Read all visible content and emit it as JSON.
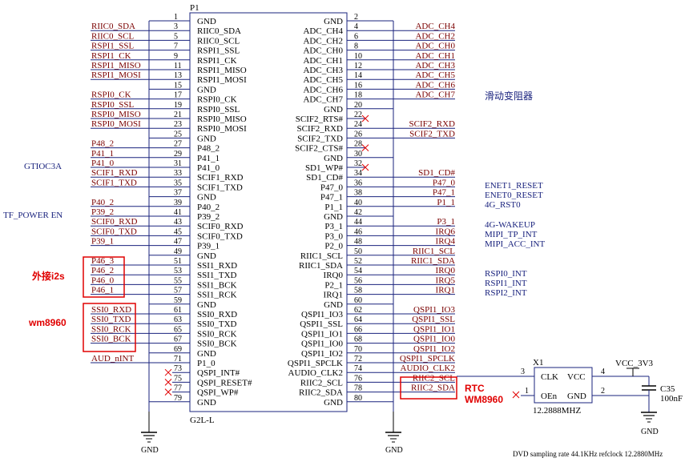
{
  "part": {
    "ref": "P1",
    "value": "G2L-L",
    "left_pins": [
      {
        "num": "1",
        "name": "GND",
        "net": ""
      },
      {
        "num": "3",
        "name": "RIIC0_SDA",
        "net": "RIIC0_SDA"
      },
      {
        "num": "5",
        "name": "RIIC0_SCL",
        "net": "RIIC0_SCL"
      },
      {
        "num": "7",
        "name": "RSPI1_SSL",
        "net": "RSPI1_SSL"
      },
      {
        "num": "9",
        "name": "RSPI1_CK",
        "net": "RSPI1_CK"
      },
      {
        "num": "11",
        "name": "RSPI1_MISO",
        "net": "RSPI1_MISO"
      },
      {
        "num": "13",
        "name": "RSPI1_MOSI",
        "net": "RSPI1_MOSI"
      },
      {
        "num": "15",
        "name": "GND",
        "net": ""
      },
      {
        "num": "17",
        "name": "RSPI0_CK",
        "net": "RSPI0_CK"
      },
      {
        "num": "19",
        "name": "RSPI0_SSL",
        "net": "RSPI0_SSL"
      },
      {
        "num": "21",
        "name": "RSPI0_MISO",
        "net": "RSPI0_MISO"
      },
      {
        "num": "23",
        "name": "RSPI0_MOSI",
        "net": "RSPI0_MOSI"
      },
      {
        "num": "25",
        "name": "GND",
        "net": ""
      },
      {
        "num": "27",
        "name": "P48_2",
        "net": "P48_2"
      },
      {
        "num": "29",
        "name": "P41_1",
        "net": "P41_1"
      },
      {
        "num": "31",
        "name": "P41_0",
        "net": "P41_0"
      },
      {
        "num": "33",
        "name": "SCIF1_RXD",
        "net": "SCIF1_RXD"
      },
      {
        "num": "35",
        "name": "SCIF1_TXD",
        "net": "SCIF1_TXD"
      },
      {
        "num": "37",
        "name": "GND",
        "net": ""
      },
      {
        "num": "39",
        "name": "P40_2",
        "net": "P40_2"
      },
      {
        "num": "41",
        "name": "P39_2",
        "net": "P39_2"
      },
      {
        "num": "43",
        "name": "SCIF0_RXD",
        "net": "SCIF0_RXD"
      },
      {
        "num": "45",
        "name": "SCIF0_TXD",
        "net": "SCIF0_TXD"
      },
      {
        "num": "47",
        "name": "P39_1",
        "net": "P39_1"
      },
      {
        "num": "49",
        "name": "GND",
        "net": ""
      },
      {
        "num": "51",
        "name": "SSI1_RXD",
        "net": "P46_3"
      },
      {
        "num": "53",
        "name": "SSI1_TXD",
        "net": "P46_2"
      },
      {
        "num": "55",
        "name": "SSI1_BCK",
        "net": "P46_0"
      },
      {
        "num": "57",
        "name": "SSI1_RCK",
        "net": "P46_1"
      },
      {
        "num": "59",
        "name": "GND",
        "net": ""
      },
      {
        "num": "61",
        "name": "SSI0_RXD",
        "net": "SSI0_RXD"
      },
      {
        "num": "63",
        "name": "SSI0_TXD",
        "net": "SSI0_TXD"
      },
      {
        "num": "65",
        "name": "SSI0_RCK",
        "net": "SSI0_RCK"
      },
      {
        "num": "67",
        "name": "SSI0_BCK",
        "net": "SSI0_BCK"
      },
      {
        "num": "69",
        "name": "GND",
        "net": ""
      },
      {
        "num": "71",
        "name": "P1_0",
        "net": "AUD_nINT"
      },
      {
        "num": "73",
        "name": "QSPI_INT#",
        "net": ""
      },
      {
        "num": "75",
        "name": "QSPI_RESET#",
        "net": ""
      },
      {
        "num": "77",
        "name": "QSPI_WP#",
        "net": ""
      },
      {
        "num": "79",
        "name": "GND",
        "net": ""
      }
    ],
    "right_pins": [
      {
        "num": "2",
        "name": "GND",
        "net": ""
      },
      {
        "num": "4",
        "name": "ADC_CH4",
        "net": "ADC_CH4"
      },
      {
        "num": "6",
        "name": "ADC_CH2",
        "net": "ADC_CH2"
      },
      {
        "num": "8",
        "name": "ADC_CH0",
        "net": "ADC_CH0"
      },
      {
        "num": "10",
        "name": "ADC_CH1",
        "net": "ADC_CH1"
      },
      {
        "num": "12",
        "name": "ADC_CH3",
        "net": "ADC_CH3"
      },
      {
        "num": "14",
        "name": "ADC_CH5",
        "net": "ADC_CH5"
      },
      {
        "num": "16",
        "name": "ADC_CH6",
        "net": "ADC_CH6"
      },
      {
        "num": "18",
        "name": "ADC_CH7",
        "net": "ADC_CH7"
      },
      {
        "num": "20",
        "name": "GND",
        "net": ""
      },
      {
        "num": "22",
        "name": "SCIF2_RTS#",
        "net": ""
      },
      {
        "num": "24",
        "name": "SCIF2_RXD",
        "net": "SCIF2_RXD"
      },
      {
        "num": "26",
        "name": "SCIF2_TXD",
        "net": "SCIF2_TXD"
      },
      {
        "num": "28",
        "name": "SCIF2_CTS#",
        "net": ""
      },
      {
        "num": "30",
        "name": "GND",
        "net": ""
      },
      {
        "num": "32",
        "name": "SD1_WP#",
        "net": ""
      },
      {
        "num": "34",
        "name": "SD1_CD#",
        "net": "SD1_CD#"
      },
      {
        "num": "36",
        "name": "P47_0",
        "net": "P47_0"
      },
      {
        "num": "38",
        "name": "P47_1",
        "net": "P47_1"
      },
      {
        "num": "40",
        "name": "P1_1",
        "net": "P1_1"
      },
      {
        "num": "42",
        "name": "GND",
        "net": ""
      },
      {
        "num": "44",
        "name": "P3_1",
        "net": "P3_1"
      },
      {
        "num": "46",
        "name": "P3_0",
        "net": "IRQ6"
      },
      {
        "num": "48",
        "name": "P2_0",
        "net": "IRQ4"
      },
      {
        "num": "50",
        "name": "RIIC1_SCL",
        "net": "RIIC1_SCL"
      },
      {
        "num": "52",
        "name": "RIIC1_SDA",
        "net": "RIIC1_SDA"
      },
      {
        "num": "54",
        "name": "IRQ0",
        "net": "IRQ0"
      },
      {
        "num": "56",
        "name": "P2_1",
        "net": "IRQ5"
      },
      {
        "num": "58",
        "name": "IRQ1",
        "net": "IRQ1"
      },
      {
        "num": "60",
        "name": "GND",
        "net": ""
      },
      {
        "num": "62",
        "name": "QSPI1_IO3",
        "net": "QSPI1_IO3"
      },
      {
        "num": "64",
        "name": "QSPI1_SSL",
        "net": "QSPI1_SSL"
      },
      {
        "num": "66",
        "name": "QSPI1_IO1",
        "net": "QSPI1_IO1"
      },
      {
        "num": "68",
        "name": "QSPI1_IO0",
        "net": "QSPI1_IO0"
      },
      {
        "num": "70",
        "name": "QSPI1_IO2",
        "net": "QSPI1_IO2"
      },
      {
        "num": "72",
        "name": "QSPI1_SPCLK",
        "net": "QSPI1_SPCLK"
      },
      {
        "num": "74",
        "name": "AUDIO_CLK2",
        "net": "AUDIO_CLK2"
      },
      {
        "num": "76",
        "name": "RIIC2_SCL",
        "net": "RIIC2_SCL"
      },
      {
        "num": "78",
        "name": "RIIC2_SDA",
        "net": "RIIC2_SDA"
      },
      {
        "num": "80",
        "name": "GND",
        "net": ""
      }
    ]
  },
  "annotations": {
    "gtioc": "GTIOC3A",
    "tf_power": "TF_POWER EN",
    "i2s": "外接i2s",
    "wm8960": "wm8960",
    "slider": "滑动变阻器",
    "enet1": "ENET1_RESET",
    "enet0": "ENET0_RESET",
    "rst4g": "4G_RST0",
    "wake4g": "4G-WAKEUP",
    "mipi_tp": "MIPI_TP_INT",
    "mipi_acc": "MIPI_ACC_INT",
    "rspi0_int": "RSPI0_INT",
    "rspi1_int": "RSPI1_INT",
    "rspi2_int": "RSPI2_INT",
    "rtc": "RTC",
    "wm8960_2": "WM8960"
  },
  "oscillator": {
    "ref": "X1",
    "value": "12.2888MHZ",
    "clk": "CLK",
    "vcc": "VCC",
    "oen": "OEn",
    "gnd": "GND",
    "pin3": "3",
    "pin4": "4",
    "pin1": "1",
    "pin2": "2"
  },
  "power": {
    "vcc": "VCC_3V3",
    "cap_ref": "C35",
    "cap_value": "100nF",
    "gnd": "GND"
  },
  "footer": "DVD sampling rate 44.1KHz refclock 12.2880MHz"
}
